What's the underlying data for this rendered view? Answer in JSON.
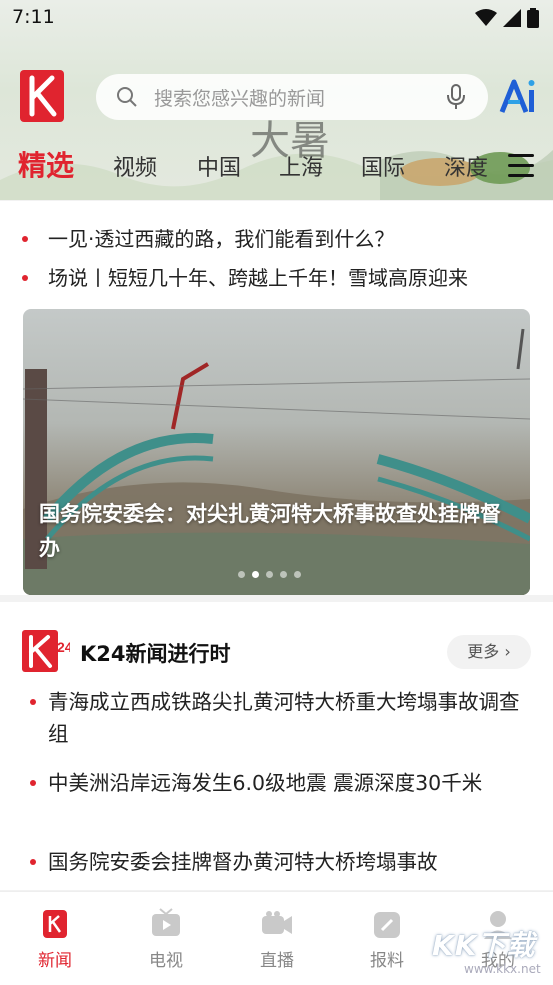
{
  "status_bar": {
    "time": "7:11"
  },
  "header": {
    "search_placeholder": "搜索您感兴趣的新闻",
    "decor_calligraphy": "大暑",
    "tabs": [
      {
        "label": "精选",
        "active": true
      },
      {
        "label": "视频"
      },
      {
        "label": "中国"
      },
      {
        "label": "上海"
      },
      {
        "label": "国际"
      },
      {
        "label": "深度"
      }
    ],
    "accent_color": "#e0242f"
  },
  "top_headlines": [
    "一见·透过西藏的路，我们能看到什么？",
    "场说丨短短几十年、跨越上千年！雪域高原迎来"
  ],
  "banner": {
    "caption": "国务院安委会：对尖扎黄河特大桥事故查处挂牌督办",
    "page_count": 5,
    "active_index": 1
  },
  "k24": {
    "title": "K24新闻进行时",
    "more_label": "更多",
    "items": [
      "青海成立西成铁路尖扎黄河特大桥重大垮塌事故调查组",
      "中美洲沿岸远海发生6.0级地震 震源深度30千米",
      "国务院安委会挂牌督办黄河特大桥垮塌事故"
    ]
  },
  "bottom_nav": [
    {
      "label": "新闻",
      "icon": "news-icon",
      "active": true
    },
    {
      "label": "电视",
      "icon": "tv-icon"
    },
    {
      "label": "直播",
      "icon": "live-camera-icon"
    },
    {
      "label": "报料",
      "icon": "report-icon"
    },
    {
      "label": "我的",
      "icon": "profile-icon"
    }
  ],
  "watermark": {
    "text": "KK下载",
    "url": "www.kkx.net"
  }
}
